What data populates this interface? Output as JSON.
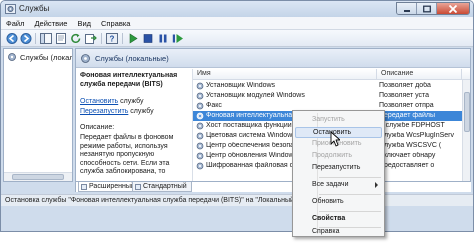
{
  "window": {
    "title": "Службы",
    "icons": {
      "app": "services-gear-icon",
      "minimize": "minimize-icon",
      "maximize": "maximize-icon",
      "close": "close-icon"
    }
  },
  "menu": {
    "items": [
      "Файл",
      "Действие",
      "Вид",
      "Справка"
    ]
  },
  "toolbar": {
    "buttons": [
      "back-icon",
      "forward-icon",
      "console-tree-icon",
      "properties-icon",
      "refresh-icon",
      "export-list-icon",
      "help-icon",
      "start-icon",
      "stop-icon",
      "pause-icon",
      "restart-icon"
    ]
  },
  "tree": {
    "item_label": "Службы (локальные"
  },
  "main": {
    "header_title": "Службы (локальные)",
    "selected_service_title": "Фоновая интеллектуальная служба передачи (BITS)",
    "stop_link": "Остановить",
    "stop_suffix": " службу",
    "restart_link": "Перезапустить",
    "restart_suffix": " службу",
    "description_label": "Описание:",
    "description_text": "Передает файлы в фоновом режиме работы, используя незанятую пропускную способность сети. Если эта служба заблокирована, то"
  },
  "list": {
    "columns": {
      "name": "Имя",
      "description": "Описание"
    },
    "rows": [
      {
        "name": "Установщик Windows",
        "description": "Позволяет доба"
      },
      {
        "name": "Установщик модулей Windows",
        "description": "Позволяет уста"
      },
      {
        "name": "Факс",
        "description": "Позволяет отпра"
      },
      {
        "name": "Фоновая интеллектуальная сл",
        "description": "Передает файлы",
        "selected": true
      },
      {
        "name": "Хост поставщика функции обн",
        "description": "В службе FDPHOST"
      },
      {
        "name": "Цветовая система Windows",
        "description": "Служба WcsPlugInServ"
      },
      {
        "name": "Центр обеспечения безопасно",
        "description": "Служба WSCSVC ("
      },
      {
        "name": "Центр обновления Windows",
        "description": "Включает обнару"
      },
      {
        "name": "Шифрованная файловая систем",
        "description": "Предоставляет о"
      }
    ]
  },
  "tabs": [
    "Расширенный",
    "Стандартный"
  ],
  "status_text": "Остановка службы \"Фоновая интеллектуальная служба передачи (BITS)\" на \"Локальный компь",
  "context_menu": {
    "items": [
      {
        "label": "Запустить",
        "disabled": true
      },
      {
        "label": "Остановить",
        "highlighted": true
      },
      {
        "label": "Приостановить",
        "disabled": true
      },
      {
        "label": "Продолжить",
        "disabled": true
      },
      {
        "label": "Перезапустить"
      },
      {
        "label": "Все задачи",
        "submenu": true
      },
      {
        "label": "Обновить"
      },
      {
        "label": "Свойства",
        "bold": true
      },
      {
        "label": "Справка"
      }
    ]
  }
}
